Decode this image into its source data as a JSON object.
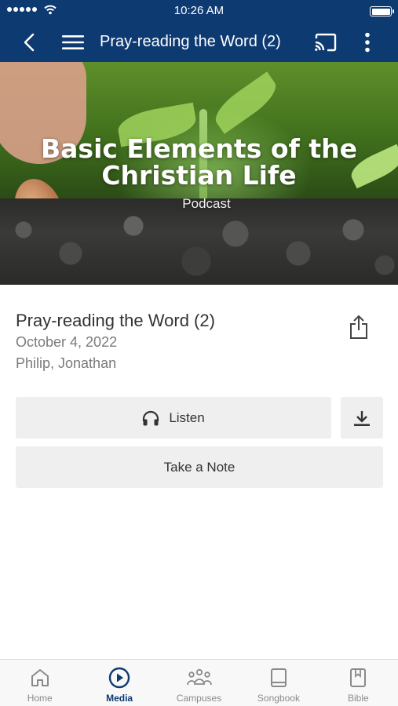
{
  "status_bar": {
    "time": "10:26 AM"
  },
  "nav": {
    "title": "Pray-reading the Word (2)"
  },
  "hero": {
    "title_line1": "Basic Elements of the",
    "title_line2": "Christian Life",
    "subtitle": "Podcast"
  },
  "item": {
    "title": "Pray-reading the Word (2)",
    "date": "October 4, 2022",
    "speakers": "Philip, Jonathan"
  },
  "actions": {
    "listen_label": "Listen",
    "note_label": "Take a Note"
  },
  "tabs": [
    {
      "label": "Home",
      "icon": "home-icon"
    },
    {
      "label": "Media",
      "icon": "play-circle-icon",
      "active": true
    },
    {
      "label": "Campuses",
      "icon": "people-icon"
    },
    {
      "label": "Songbook",
      "icon": "book-icon"
    },
    {
      "label": "Bible",
      "icon": "bookmark-book-icon"
    }
  ],
  "colors": {
    "primary": "#0e3a72",
    "button_bg": "#efefef",
    "tab_inactive": "#8a8a8a"
  }
}
